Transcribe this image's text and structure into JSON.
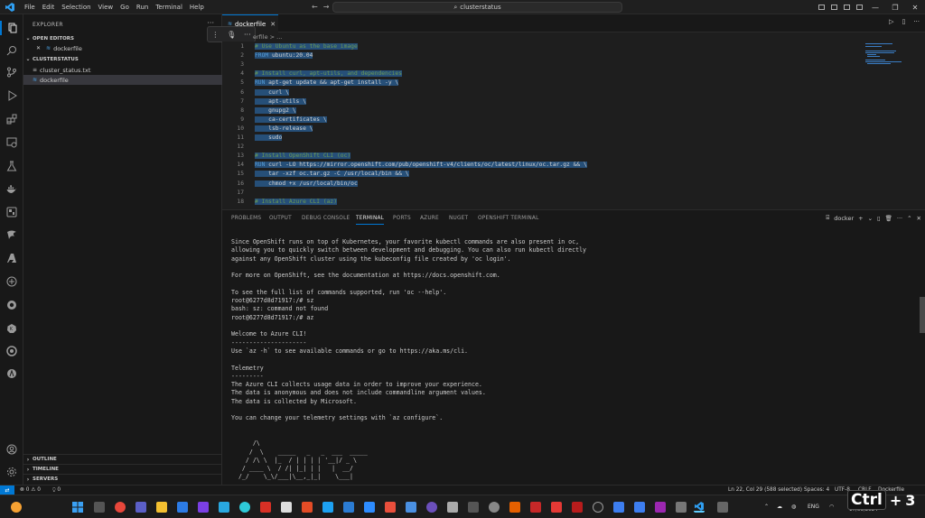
{
  "titlebar": {
    "menu": [
      "File",
      "Edit",
      "Selection",
      "View",
      "Go",
      "Run",
      "Terminal",
      "Help"
    ],
    "search_text": "clusterstatus"
  },
  "sidebar": {
    "title": "EXPLORER",
    "open_editors_label": "OPEN EDITORS",
    "open_editor_file": "dockerfile",
    "folder_label": "CLUSTERSTATUS",
    "files": [
      {
        "name": "cluster_status.txt"
      },
      {
        "name": "dockerfile"
      }
    ],
    "outline_label": "OUTLINE",
    "timeline_label": "TIMELINE",
    "servers_label": "SERVERS"
  },
  "editor": {
    "tab_label": "dockerfile",
    "breadcrumb": "erfile > ...",
    "lines": [
      {
        "n": "1",
        "text": "# Use Ubuntu as the base image"
      },
      {
        "n": "2",
        "text": "FROM ubuntu:20.04"
      },
      {
        "n": "3",
        "text": ""
      },
      {
        "n": "4",
        "text": "# Install curl, apt-utils, and dependencies"
      },
      {
        "n": "5",
        "text": "RUN apt-get update && apt-get install -y \\"
      },
      {
        "n": "6",
        "text": "    curl \\"
      },
      {
        "n": "7",
        "text": "    apt-utils \\"
      },
      {
        "n": "8",
        "text": "    gnupg2 \\"
      },
      {
        "n": "9",
        "text": "    ca-certificates \\"
      },
      {
        "n": "10",
        "text": "    lsb-release \\"
      },
      {
        "n": "11",
        "text": "    sudo"
      },
      {
        "n": "12",
        "text": ""
      },
      {
        "n": "13",
        "text": "# Install OpenShift CLI (oc)"
      },
      {
        "n": "14",
        "text": "RUN curl -LO https://mirror.openshift.com/pub/openshift-v4/clients/oc/latest/linux/oc.tar.gz && \\"
      },
      {
        "n": "15",
        "text": "    tar -xzf oc.tar.gz -C /usr/local/bin && \\"
      },
      {
        "n": "16",
        "text": "    chmod +x /usr/local/bin/oc"
      },
      {
        "n": "17",
        "text": ""
      },
      {
        "n": "18",
        "text": "# Install Azure CLI (az)"
      }
    ]
  },
  "panel": {
    "tabs": [
      "PROBLEMS",
      "OUTPUT",
      "DEBUG CONSOLE",
      "TERMINAL",
      "PORTS",
      "AZURE",
      "NUGET",
      "OPENSHIFT TERMINAL"
    ],
    "active_tab": "TERMINAL",
    "terminal_name": "docker",
    "terminal_lines": [
      "Since OpenShift runs on top of Kubernetes, your favorite kubectl commands are also present in oc,",
      "allowing you to quickly switch between development and debugging. You can also run kubectl directly",
      "against any OpenShift cluster using the kubeconfig file created by 'oc login'.",
      "",
      "For more on OpenShift, see the documentation at https://docs.openshift.com.",
      "",
      "To see the full list of commands supported, run 'oc --help'.",
      "root@6277d8d71917:/# sz",
      "bash: sz: command not found",
      "root@6277d8d71917:/# az",
      "",
      "Welcome to Azure CLI!",
      "---------------------",
      "Use `az -h` to see available commands or go to https://aka.ms/cli.",
      "",
      "Telemetry",
      "---------",
      "The Azure CLI collects usage data in order to improve your experience.",
      "The data is anonymous and does not include commandline argument values.",
      "The data is collected by Microsoft.",
      "",
      "You can change your telemetry settings with `az configure`.",
      "",
      "",
      "      /\\",
      "     /  \\    _____   _   _  ___  _____",
      "    / /\\ \\  |_  / | | | | '__|/ _ \\",
      "   / ____ \\  / /| |_| | |   |  __/",
      "  /_/    \\_\\/___|\\__,_|_|    \\___|"
    ]
  },
  "status": {
    "errors": "0",
    "warnings": "0",
    "ports": "0",
    "cursor": "Ln 22, Col 29 (588 selected)",
    "spaces": "Spaces: 4",
    "encoding": "UTF-8",
    "eol": "CRLF",
    "language": "Dockerfile"
  },
  "taskbar": {
    "lang": "ENG",
    "date": "17/09/2024",
    "overlay_key": "Ctrl",
    "overlay_plus": "+",
    "overlay_num": "3"
  }
}
